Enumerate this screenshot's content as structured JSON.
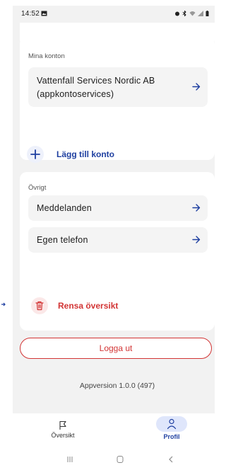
{
  "status_bar": {
    "time": "14:52"
  },
  "accounts": {
    "section_label": "Mina konton",
    "items": [
      {
        "name_line1": "Vattenfall Services Nordic AB",
        "name_line2": "(appkontoservices)"
      }
    ],
    "add_label": "Lägg till konto"
  },
  "other": {
    "section_label": "Övrigt",
    "items": [
      {
        "label": "Meddelanden"
      },
      {
        "label": "Egen telefon"
      }
    ],
    "clear_label": "Rensa översikt"
  },
  "logout_label": "Logga ut",
  "version": "Appversion 1.0.0 (497)",
  "nav": {
    "overview_label": "Översikt",
    "profile_label": "Profil"
  },
  "colors": {
    "accent_blue": "#1e3fa0",
    "danger_red": "#d23434",
    "background": "#f2f2f2"
  },
  "icons": [
    "image-icon",
    "alarm-icon",
    "bluetooth-icon",
    "wifi-icon",
    "signal-icon",
    "battery-icon",
    "arrow-right-icon",
    "plus-icon",
    "trash-icon",
    "flag-icon",
    "person-icon",
    "recents-icon",
    "home-icon",
    "back-icon"
  ]
}
